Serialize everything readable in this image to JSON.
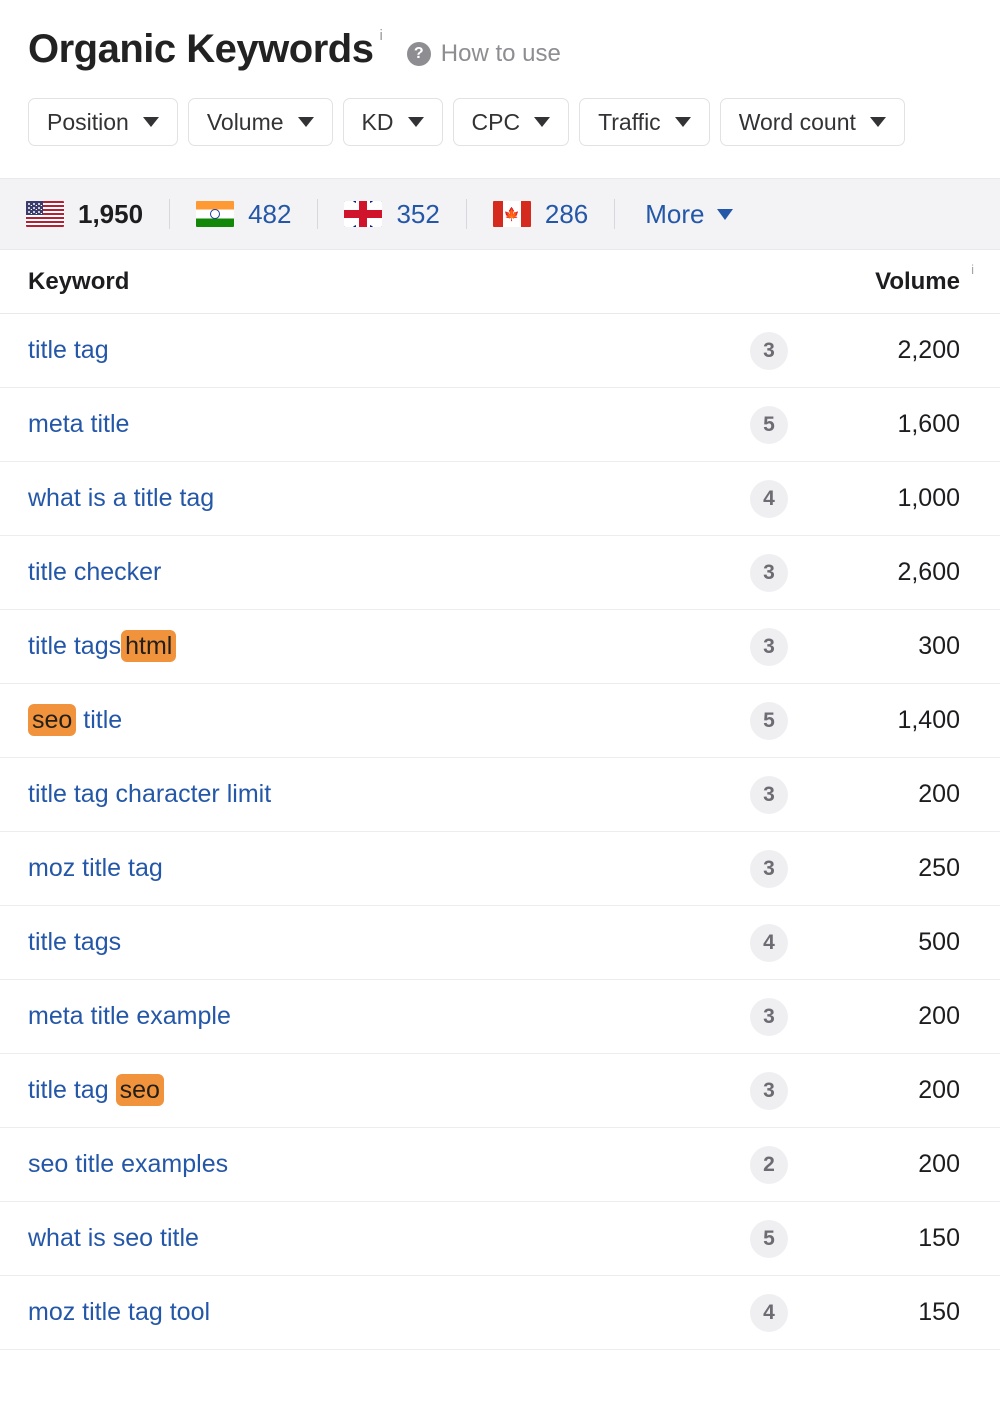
{
  "header": {
    "title": "Organic Keywords",
    "title_info_sup": "i",
    "help_icon": "question-mark-circle-icon",
    "how_to_use_label": "How to use"
  },
  "filters": [
    {
      "label": "Position",
      "icon": "chevron-down-icon"
    },
    {
      "label": "Volume",
      "icon": "chevron-down-icon"
    },
    {
      "label": "KD",
      "icon": "chevron-down-icon"
    },
    {
      "label": "CPC",
      "icon": "chevron-down-icon"
    },
    {
      "label": "Traffic",
      "icon": "chevron-down-icon"
    },
    {
      "label": "Word count",
      "icon": "chevron-down-icon"
    }
  ],
  "countries": [
    {
      "code": "us",
      "flag_icon": "flag-us-icon",
      "count": "1,950",
      "active": true
    },
    {
      "code": "in",
      "flag_icon": "flag-in-icon",
      "count": "482",
      "active": false
    },
    {
      "code": "gb",
      "flag_icon": "flag-gb-icon",
      "count": "352",
      "active": false
    },
    {
      "code": "ca",
      "flag_icon": "flag-ca-icon",
      "count": "286",
      "active": false
    }
  ],
  "more_label": "More",
  "table": {
    "headers": {
      "keyword": "Keyword",
      "volume": "Volume",
      "volume_sup": "i"
    },
    "rows": [
      {
        "keyword": "title tag",
        "parts": [
          {
            "t": "title tag",
            "hl": false
          }
        ],
        "position": "3",
        "volume": "2,200"
      },
      {
        "keyword": "meta title",
        "parts": [
          {
            "t": "meta title",
            "hl": false
          }
        ],
        "position": "5",
        "volume": "1,600"
      },
      {
        "keyword": "what is a title tag",
        "parts": [
          {
            "t": "what is a title tag",
            "hl": false
          }
        ],
        "position": "4",
        "volume": "1,000"
      },
      {
        "keyword": "title checker",
        "parts": [
          {
            "t": "title checker",
            "hl": false
          }
        ],
        "position": "3",
        "volume": "2,600"
      },
      {
        "keyword": "title tags html",
        "parts": [
          {
            "t": "title tags",
            "hl": false
          },
          {
            "t": "html",
            "hl": true
          }
        ],
        "position": "3",
        "volume": "300"
      },
      {
        "keyword": "seo title",
        "parts": [
          {
            "t": "seo",
            "hl": true
          },
          {
            "t": " title",
            "hl": false
          }
        ],
        "position": "5",
        "volume": "1,400"
      },
      {
        "keyword": "title tag character limit",
        "parts": [
          {
            "t": "title tag character limit",
            "hl": false
          }
        ],
        "position": "3",
        "volume": "200"
      },
      {
        "keyword": "moz title tag",
        "parts": [
          {
            "t": "moz title tag",
            "hl": false
          }
        ],
        "position": "3",
        "volume": "250"
      },
      {
        "keyword": "title tags",
        "parts": [
          {
            "t": "title tags",
            "hl": false
          }
        ],
        "position": "4",
        "volume": "500"
      },
      {
        "keyword": "meta title example",
        "parts": [
          {
            "t": "meta title example",
            "hl": false
          }
        ],
        "position": "3",
        "volume": "200"
      },
      {
        "keyword": "title tag seo",
        "parts": [
          {
            "t": "title tag ",
            "hl": false
          },
          {
            "t": "seo",
            "hl": true
          }
        ],
        "position": "3",
        "volume": "200"
      },
      {
        "keyword": "seo title examples",
        "parts": [
          {
            "t": "seo title examples",
            "hl": false
          }
        ],
        "position": "2",
        "volume": "200"
      },
      {
        "keyword": "what is seo title",
        "parts": [
          {
            "t": "what is seo title",
            "hl": false
          }
        ],
        "position": "5",
        "volume": "150"
      },
      {
        "keyword": "moz title tag tool",
        "parts": [
          {
            "t": "moz title tag tool",
            "hl": false
          }
        ],
        "position": "4",
        "volume": "150"
      }
    ]
  },
  "colors": {
    "link_blue": "#2457a7",
    "highlight_orange": "#f0933c",
    "country_bar_bg": "#f3f3f5",
    "badge_bg": "#efeff2",
    "text_dark": "#1d1d20",
    "muted_gray": "#8d8d92"
  }
}
